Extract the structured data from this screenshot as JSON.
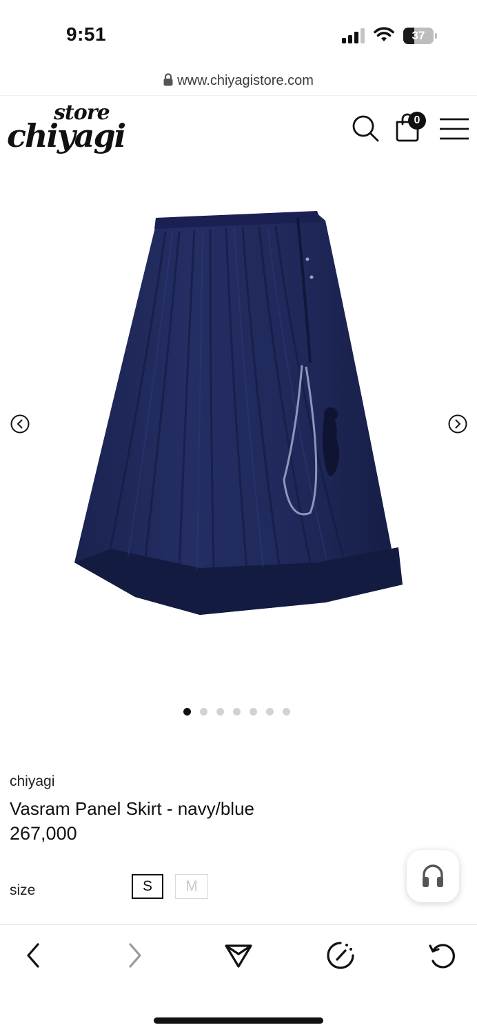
{
  "status_bar": {
    "time": "9:51",
    "battery_level": "37"
  },
  "browser": {
    "url": "www.chiyagistore.com"
  },
  "header": {
    "logo_small": "store",
    "logo_main": "chiyagi",
    "cart_count": "0"
  },
  "carousel": {
    "total_images": 7,
    "active_index": 0
  },
  "product": {
    "brand": "chiyagi",
    "title": "Vasram Panel Skirt - navy/blue",
    "price": "267,000",
    "size_label": "size",
    "sizes": [
      "S",
      "M"
    ],
    "selected_size": "S"
  },
  "icons": {
    "header": [
      "search-icon",
      "shopping-bag-icon",
      "menu-icon"
    ],
    "carousel": [
      "chevron-left-circle-icon",
      "chevron-right-circle-icon"
    ],
    "toolbar": [
      "back-icon",
      "forward-icon",
      "share-icon",
      "compass-icon",
      "reload-icon"
    ],
    "floating": "headset-icon"
  },
  "colors": {
    "skirt_navy": "#1b2550",
    "accent": "#111111"
  }
}
